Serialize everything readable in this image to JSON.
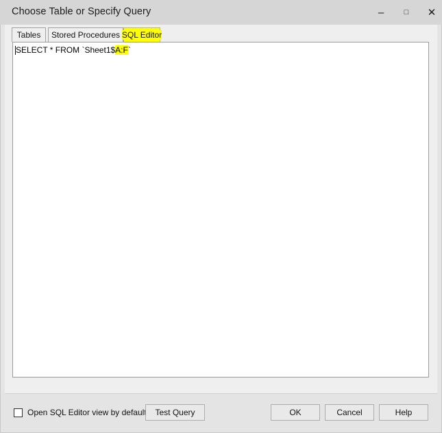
{
  "window": {
    "title": "Choose Table or Specify Query",
    "controls": {
      "minimize": "–",
      "maximize": "□",
      "close": "✕"
    }
  },
  "tabs": [
    {
      "id": "tables",
      "label": "Tables",
      "selected": false
    },
    {
      "id": "stored_procedures",
      "label": "Stored Procedures",
      "selected": false
    },
    {
      "id": "sql_editor",
      "label": "SQL Editor",
      "selected": true,
      "highlight_color": "#ffff00"
    }
  ],
  "editor": {
    "sql_prefix": "SELECT * FROM `Sheet1$",
    "sql_highlight": "A:F",
    "sql_suffix": "`",
    "full_text": "SELECT * FROM `Sheet1$A:F`",
    "highlight_color": "#ffff00"
  },
  "footer": {
    "checkbox": {
      "label": "Open SQL Editor view by default",
      "checked": false
    },
    "buttons": {
      "test_query": "Test Query",
      "ok": "OK",
      "cancel": "Cancel",
      "help": "Help"
    }
  },
  "colors": {
    "titlebar": "#d6d6d6",
    "dialog_background": "#e4e4e4",
    "panel_background": "#efefef",
    "editor_background": "#ffffff",
    "highlight": "#ffff00"
  }
}
